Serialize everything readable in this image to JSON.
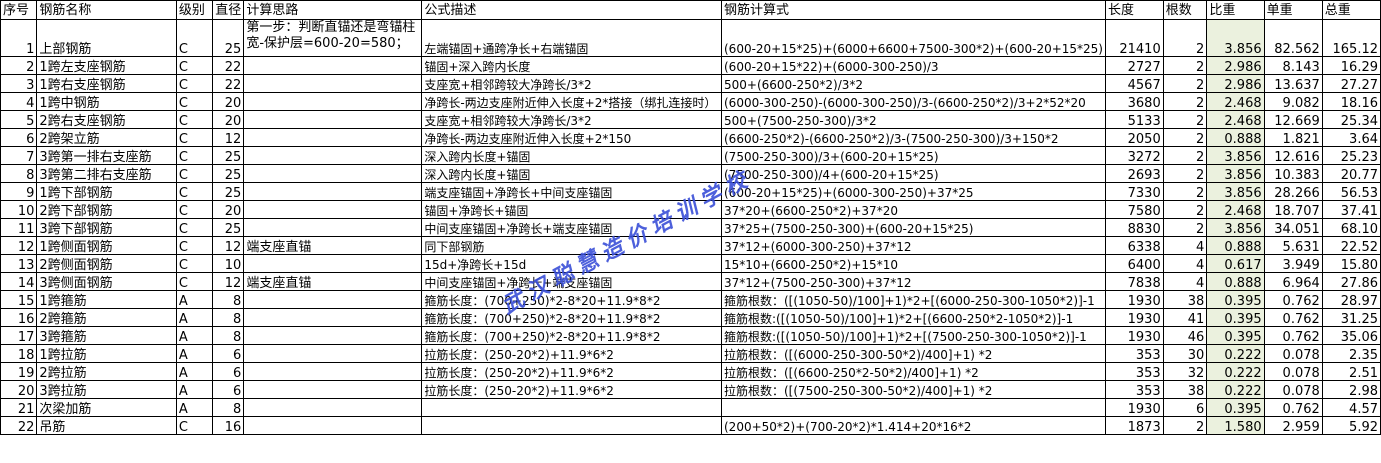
{
  "headers": [
    "序号",
    "钢筋名称",
    "级别",
    "直径",
    "计算思路",
    "公式描述",
    "钢筋计算式",
    "长度",
    "根数",
    "比重",
    "单重",
    "总重"
  ],
  "note_row1": "第一步：判断直锚还是弯锚柱宽-保护层=600-20=580；",
  "rows": [
    {
      "no": "1",
      "name": "上部钢筋",
      "grade": "C",
      "dia": "25",
      "idea": "",
      "desc": "左端锚固+通跨净长+右端锚固",
      "formula": "(600-20+15*25)+(6000+6600+7500-300*2)+(600-20+15*25)",
      "len": "21410",
      "count": "2",
      "ratio": "3.856",
      "unit": "82.562",
      "total": "165.12"
    },
    {
      "no": "2",
      "name": "1跨左支座钢筋",
      "grade": "C",
      "dia": "22",
      "idea": "",
      "desc": "锚固+深入跨内长度",
      "formula": "(600-20+15*22)+(6000-300-250)/3",
      "len": "2727",
      "count": "2",
      "ratio": "2.986",
      "unit": "8.143",
      "total": "16.29"
    },
    {
      "no": "3",
      "name": "1跨右支座钢筋",
      "grade": "C",
      "dia": "22",
      "idea": "",
      "desc": "支座宽+相邻跨较大净跨长/3*2",
      "formula": "500+(6600-250*2)/3*2",
      "len": "4567",
      "count": "2",
      "ratio": "2.986",
      "unit": "13.637",
      "total": "27.27"
    },
    {
      "no": "4",
      "name": "1跨中钢筋",
      "grade": "C",
      "dia": "20",
      "idea": "",
      "desc": "净跨长-两边支座附近伸入长度+2*搭接（绑扎连接时）",
      "formula": "(6000-300-250)-(6000-300-250)/3-(6600-250*2)/3+2*52*20",
      "len": "3680",
      "count": "2",
      "ratio": "2.468",
      "unit": "9.082",
      "total": "18.16"
    },
    {
      "no": "5",
      "name": "2跨右支座钢筋",
      "grade": "C",
      "dia": "20",
      "idea": "",
      "desc": "支座宽+相邻跨较大净跨长/3*2",
      "formula": "500+(7500-250-300)/3*2",
      "len": "5133",
      "count": "2",
      "ratio": "2.468",
      "unit": "12.669",
      "total": "25.34"
    },
    {
      "no": "6",
      "name": "2跨架立筋",
      "grade": "C",
      "dia": "12",
      "idea": "",
      "desc": "净跨长-两边支座附近伸入长度+2*150",
      "formula": "(6600-250*2)-(6600-250*2)/3-(7500-250-300)/3+150*2",
      "len": "2050",
      "count": "2",
      "ratio": "0.888",
      "unit": "1.821",
      "total": "3.64"
    },
    {
      "no": "7",
      "name": "3跨第一排右支座筋",
      "grade": "C",
      "dia": "25",
      "idea": "",
      "desc": "深入跨内长度+锚固",
      "formula": "(7500-250-300)/3+(600-20+15*25)",
      "len": "3272",
      "count": "2",
      "ratio": "3.856",
      "unit": "12.616",
      "total": "25.23"
    },
    {
      "no": "8",
      "name": "3跨第二排右支座筋",
      "grade": "C",
      "dia": "25",
      "idea": "",
      "desc": "深入跨内长度+锚固",
      "formula": "(7500-250-300)/4+(600-20+15*25)",
      "len": "2693",
      "count": "2",
      "ratio": "3.856",
      "unit": "10.383",
      "total": "20.77"
    },
    {
      "no": "9",
      "name": "1跨下部钢筋",
      "grade": "C",
      "dia": "25",
      "idea": "",
      "desc": "端支座锚固+净跨长+中间支座锚固",
      "formula": "(600-20+15*25)+(6000-300-250)+37*25",
      "len": "7330",
      "count": "2",
      "ratio": "3.856",
      "unit": "28.266",
      "total": "56.53"
    },
    {
      "no": "10",
      "name": "2跨下部钢筋",
      "grade": "C",
      "dia": "20",
      "idea": "",
      "desc": "锚固+净跨长+锚固",
      "formula": "37*20+(6600-250*2)+37*20",
      "len": "7580",
      "count": "2",
      "ratio": "2.468",
      "unit": "18.707",
      "total": "37.41"
    },
    {
      "no": "11",
      "name": "3跨下部钢筋",
      "grade": "C",
      "dia": "25",
      "idea": "",
      "desc": "中间支座锚固+净跨长+端支座锚固",
      "formula": "37*25+(7500-250-300)+(600-20+15*25)",
      "len": "8830",
      "count": "2",
      "ratio": "3.856",
      "unit": "34.051",
      "total": "68.10"
    },
    {
      "no": "12",
      "name": "1跨侧面钢筋",
      "grade": "C",
      "dia": "12",
      "idea": "端支座直锚",
      "desc": "同下部钢筋",
      "formula": "37*12+(6000-300-250)+37*12",
      "len": "6338",
      "count": "4",
      "ratio": "0.888",
      "unit": "5.631",
      "total": "22.52"
    },
    {
      "no": "13",
      "name": "2跨侧面钢筋",
      "grade": "C",
      "dia": "10",
      "idea": "",
      "desc": "15d+净跨长+15d",
      "formula": "15*10+(6600-250*2)+15*10",
      "len": "6400",
      "count": "4",
      "ratio": "0.617",
      "unit": "3.949",
      "total": "15.80"
    },
    {
      "no": "14",
      "name": "3跨侧面钢筋",
      "grade": "C",
      "dia": "12",
      "idea": "端支座直锚",
      "desc": "中间支座锚固+净跨长+端支座锚固",
      "formula": "37*12+(7500-250-300)+37*12",
      "len": "7838",
      "count": "4",
      "ratio": "0.888",
      "unit": "6.964",
      "total": "27.86"
    },
    {
      "no": "15",
      "name": "1跨箍筋",
      "grade": "A",
      "dia": "8",
      "idea": "",
      "desc": "箍筋长度：(700+250)*2-8*20+11.9*8*2",
      "formula": "箍筋根数：([(1050-50)/100]+1)*2+[(6000-250-300-1050*2)]-1",
      "len": "1930",
      "count": "38",
      "ratio": "0.395",
      "unit": "0.762",
      "total": "28.97"
    },
    {
      "no": "16",
      "name": "2跨箍筋",
      "grade": "A",
      "dia": "8",
      "idea": "",
      "desc": "箍筋长度：(700+250)*2-8*20+11.9*8*2",
      "formula": "箍筋根数:([(1050-50)/100]+1)*2+[(6600-250*2-1050*2)]-1",
      "len": "1930",
      "count": "41",
      "ratio": "0.395",
      "unit": "0.762",
      "total": "31.25"
    },
    {
      "no": "17",
      "name": "3跨箍筋",
      "grade": "A",
      "dia": "8",
      "idea": "",
      "desc": "箍筋长度：(700+250)*2-8*20+11.9*8*2",
      "formula": "箍筋根数:([(1050-50)/100]+1)*2+[(7500-250-300-1050*2)]-1",
      "len": "1930",
      "count": "46",
      "ratio": "0.395",
      "unit": "0.762",
      "total": "35.06"
    },
    {
      "no": "18",
      "name": "1跨拉筋",
      "grade": "A",
      "dia": "6",
      "idea": "",
      "desc": "拉筋长度：(250-20*2)+11.9*6*2",
      "formula": "拉筋根数：([(6000-250-300-50*2)/400]+1) *2",
      "len": "353",
      "count": "30",
      "ratio": "0.222",
      "unit": "0.078",
      "total": "2.35"
    },
    {
      "no": "19",
      "name": "2跨拉筋",
      "grade": "A",
      "dia": "6",
      "idea": "",
      "desc": "拉筋长度：(250-20*2)+11.9*6*2",
      "formula": "拉筋根数：([(6600-250*2-50*2)/400]+1) *2",
      "len": "353",
      "count": "32",
      "ratio": "0.222",
      "unit": "0.078",
      "total": "2.51"
    },
    {
      "no": "20",
      "name": "3跨拉筋",
      "grade": "A",
      "dia": "6",
      "idea": "",
      "desc": "拉筋长度：(250-20*2)+11.9*6*2",
      "formula": "拉筋根数：([(7500-250-300-50*2)/400]+1) *2",
      "len": "353",
      "count": "38",
      "ratio": "0.222",
      "unit": "0.078",
      "total": "2.98"
    },
    {
      "no": "21",
      "name": "次梁加筋",
      "grade": "A",
      "dia": "8",
      "idea": "",
      "desc": "",
      "formula": "",
      "len": "1930",
      "count": "6",
      "ratio": "0.395",
      "unit": "0.762",
      "total": "4.57"
    },
    {
      "no": "22",
      "name": "吊筋",
      "grade": "C",
      "dia": "16",
      "idea": "",
      "desc": "",
      "formula": "(200+50*2)+(700-20*2)*1.414+20*16*2",
      "len": "1873",
      "count": "2",
      "ratio": "1.580",
      "unit": "2.959",
      "total": "5.92"
    }
  ],
  "watermark": "武汉聪慧造价培训学校",
  "colors": {
    "grid": "#000000",
    "ratio_bg": "#ebf1de",
    "watermark": "#3a4fd8"
  }
}
